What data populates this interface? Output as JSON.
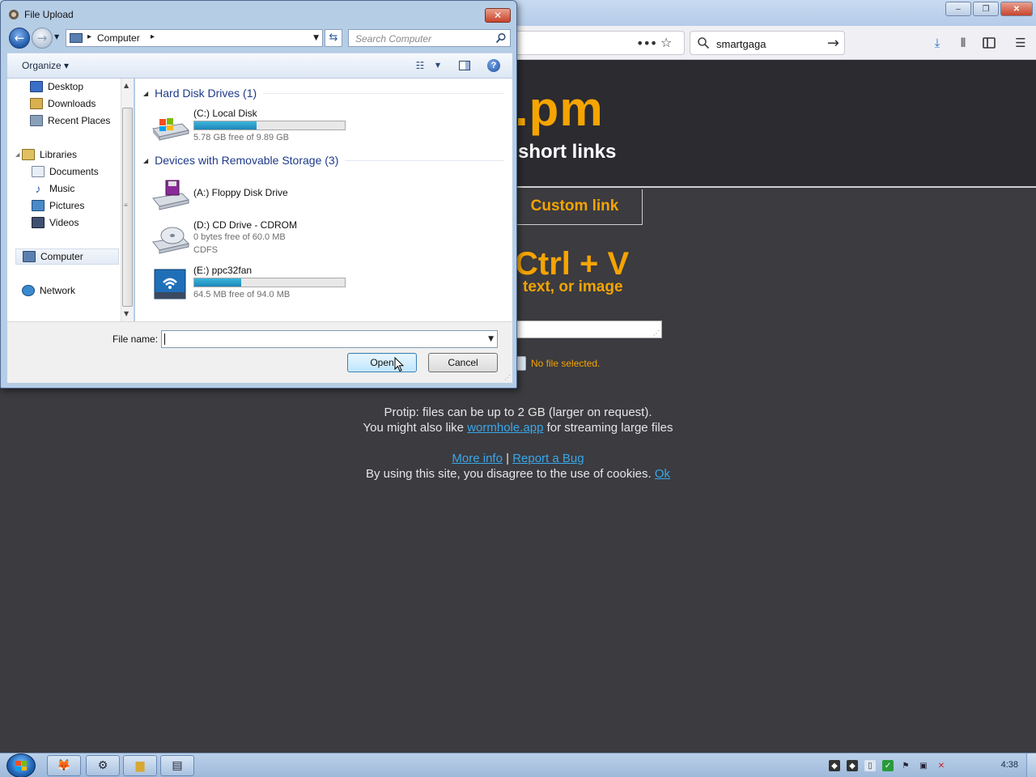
{
  "browser": {
    "search_text": "smartgaga",
    "window_controls": [
      "–",
      "❐",
      "✕"
    ]
  },
  "page": {
    "logo": ".pm",
    "tagline": "short links",
    "tab_custom": "Custom link",
    "paste_title": "Ctrl + V",
    "paste_sub": "text, or image",
    "no_file": "No file selected.",
    "protip_1": "Protip: files can be up to 2 GB (larger on request).",
    "protip_2_pre": "You might also like",
    "protip_2_link": "wormhole.app",
    "protip_2_post": "for streaming large files",
    "more_info": "More info",
    "sep": "|",
    "report_bug": "Report a Bug",
    "cookie_text": "By using this site, you disagree to the use of cookies.",
    "cookie_ok": "Ok"
  },
  "dialog": {
    "title": "File Upload",
    "close": "✕",
    "address_crumb": "Computer",
    "search_placeholder": "Search Computer",
    "organize": "Organize",
    "nav_items": [
      {
        "label": "Desktop",
        "color": "#3a6fc8"
      },
      {
        "label": "Downloads",
        "color": "#d8b050"
      },
      {
        "label": "Recent Places",
        "color": "#8aa0b8"
      },
      {
        "label": "Libraries",
        "color": "#e0c060"
      },
      {
        "label": "Documents",
        "color": "#c8d4e4"
      },
      {
        "label": "Music",
        "color": "#2a5ab0"
      },
      {
        "label": "Pictures",
        "color": "#4a8ac8"
      },
      {
        "label": "Videos",
        "color": "#405070"
      },
      {
        "label": "Computer",
        "color": "#5a7fb0"
      },
      {
        "label": "Network",
        "color": "#3a8ad0"
      }
    ],
    "groups": [
      {
        "label": "Hard Disk Drives (1)"
      },
      {
        "label": "Devices with Removable Storage (3)"
      }
    ],
    "drives": [
      {
        "name": "(C:) Local Disk",
        "sub": "5.78 GB free of 9.89 GB",
        "sub2": "",
        "fill": 0.416
      },
      {
        "name": "(A:) Floppy Disk Drive",
        "sub": "",
        "sub2": ""
      },
      {
        "name": "(D:) CD Drive - CDROM",
        "sub": "0 bytes free of 60.0 MB",
        "sub2": "CDFS"
      },
      {
        "name": "(E:) ppc32fan",
        "sub": "64.5 MB free of 94.0 MB",
        "fill": 0.314
      }
    ],
    "file_name_label": "File name:",
    "file_name_value": "",
    "open_label": "Open",
    "cancel_label": "Cancel"
  },
  "taskbar": {
    "clock": "4:38"
  },
  "colors": {
    "accent_orange": "#f5a400",
    "link_blue": "#3aa7e8",
    "page_bg": "#3b3b40"
  }
}
